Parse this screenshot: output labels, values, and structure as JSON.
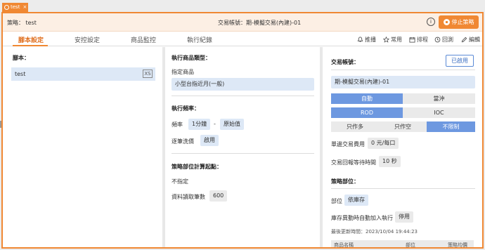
{
  "window_tab": {
    "label": "test"
  },
  "header": {
    "strategy_label": "策略：",
    "strategy_name": "test",
    "account_text": "交易帳號：期-模擬交易(內建)-01",
    "stop_button": "停止策略"
  },
  "tabs": [
    "腳本設定",
    "安控設定",
    "商品監控",
    "執行紀錄"
  ],
  "toolbar": [
    "推播",
    "常用",
    "排程",
    "回測",
    "編輯"
  ],
  "left": {
    "title": "腳本：",
    "script_name": "test",
    "script_icon": "XS"
  },
  "middle": {
    "product_type_title": "執行商品類型：",
    "product_type_label": "指定商品",
    "product_value": "小型台指近月(一般)",
    "frequency_title": "執行頻率：",
    "frequency_label": "頻率",
    "frequency_value": "1分鐘",
    "frequency_dash": "-",
    "frequency_base": "原始值",
    "tick_label": "逐筆洗價",
    "tick_value": "啟用",
    "position_title": "策略部位計算起點：",
    "position_value": "不指定",
    "bars_label": "資料讀取筆數",
    "bars_value": "600"
  },
  "right": {
    "account_title": "交易帳號：",
    "enabled_button": "已啟用",
    "account_value": "期-模擬交易(內建)-01",
    "mode_options": [
      "自動",
      "當沖"
    ],
    "mode_selected": "自動",
    "order_type_options": [
      "ROD",
      "IOC"
    ],
    "order_type_selected": "ROD",
    "direction_options": [
      "只作多",
      "只作空",
      "不限制"
    ],
    "direction_selected": "不限制",
    "fee_label": "單邊交易費用",
    "fee_value": "0 元/每口",
    "wait_label": "交易回報等待時間",
    "wait_value": "10 秒",
    "position_title": "策略部位：",
    "position_label": "部位",
    "position_value": "依庫存",
    "auto_join_label": "庫存異動時自動加入執行",
    "auto_join_value": "停用",
    "last_update": "最後更新時間：2023/10/04 19:44:23",
    "table_headers": [
      "商品名稱",
      "部位",
      "策略均價"
    ]
  },
  "colors": {
    "accent": "#f08833",
    "selected_blue": "#6d98e0",
    "field_blue": "#dde8f6"
  }
}
